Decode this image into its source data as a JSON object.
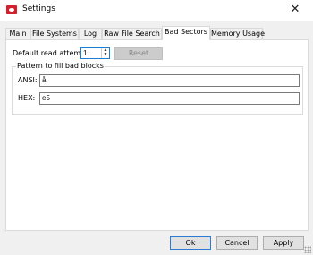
{
  "window": {
    "title": "Settings",
    "close_glyph": "✕",
    "app_icon": "app-logo-icon"
  },
  "tabs": [
    {
      "label": "Main",
      "active": false
    },
    {
      "label": "File Systems",
      "active": false
    },
    {
      "label": "Log",
      "active": false
    },
    {
      "label": "Raw File Search",
      "active": false
    },
    {
      "label": "Bad Sectors",
      "active": true
    },
    {
      "label": "Memory Usage",
      "active": false
    }
  ],
  "bad_sectors": {
    "read_attempts_label": "Default read attempts:",
    "read_attempts_value": "1",
    "reset_label": "Reset",
    "pattern_group_title": "Pattern to fill bad blocks",
    "ansi_label": "ANSI:",
    "ansi_value": "å",
    "hex_label": "HEX:",
    "hex_value": "e5"
  },
  "footer": {
    "ok_label": "Ok",
    "cancel_label": "Cancel",
    "apply_label": "Apply"
  },
  "colors": {
    "accent": "#1a7fd4",
    "app_icon": "#d61f2c"
  }
}
